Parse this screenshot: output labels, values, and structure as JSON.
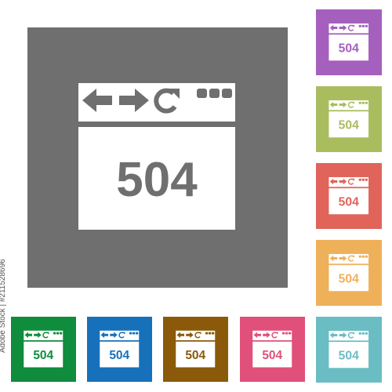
{
  "icon_text": "504",
  "watermark": "Adobe Stock | #211528696",
  "tiles": [
    {
      "name": "gray",
      "color": "#6f6f6f"
    },
    {
      "name": "purple",
      "color": "#a55fbd"
    },
    {
      "name": "olive",
      "color": "#a9bd5f"
    },
    {
      "name": "red",
      "color": "#e0645a"
    },
    {
      "name": "orange",
      "color": "#efb05a"
    },
    {
      "name": "teal",
      "color": "#6bbdc4"
    },
    {
      "name": "green",
      "color": "#0f8c3c"
    },
    {
      "name": "blue",
      "color": "#1771ba"
    },
    {
      "name": "brown",
      "color": "#8a5a0a"
    },
    {
      "name": "pink",
      "color": "#e0507a"
    },
    {
      "name": "teal-bottom",
      "color": "#6bbdc4"
    }
  ]
}
